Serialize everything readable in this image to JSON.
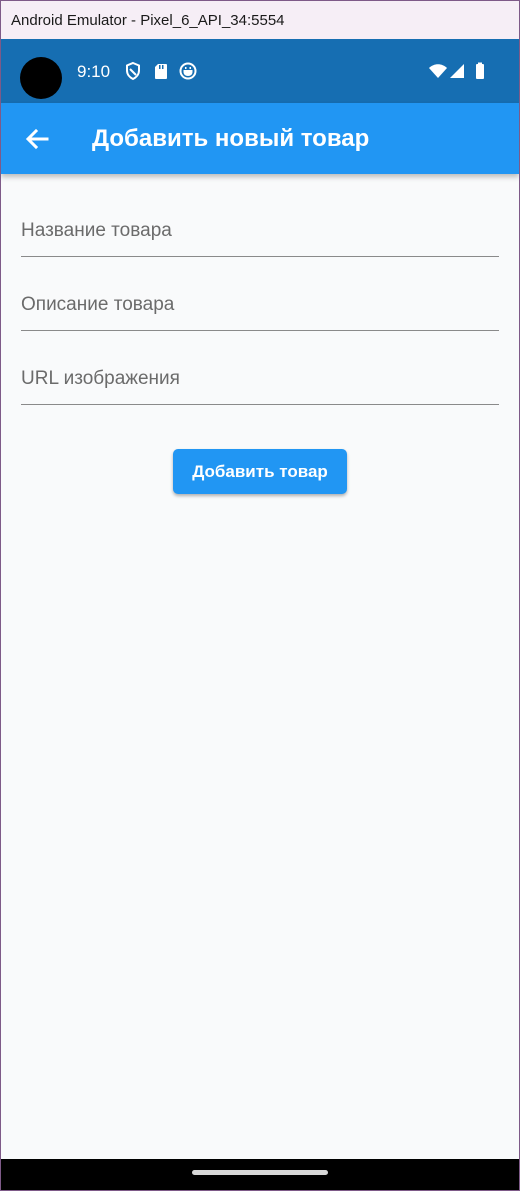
{
  "window": {
    "title": "Android Emulator - Pixel_6_API_34:5554"
  },
  "status_bar": {
    "time": "9:10",
    "left_icons": [
      "shield-icon",
      "sd-card-icon",
      "app-notification-icon"
    ],
    "right_icons": [
      "wifi-icon",
      "signal-icon",
      "battery-icon"
    ]
  },
  "app_bar": {
    "back_icon": "arrow-back-icon",
    "title": "Добавить новый товар",
    "color": "#2196f3"
  },
  "form": {
    "fields": [
      {
        "placeholder": "Название товара",
        "value": ""
      },
      {
        "placeholder": "Описание товара",
        "value": ""
      },
      {
        "placeholder": "URL изображения",
        "value": ""
      }
    ],
    "submit_label": "Добавить товар"
  },
  "colors": {
    "status_bar": "#166eb2",
    "accent": "#2196f3",
    "background": "#f9fafb"
  }
}
